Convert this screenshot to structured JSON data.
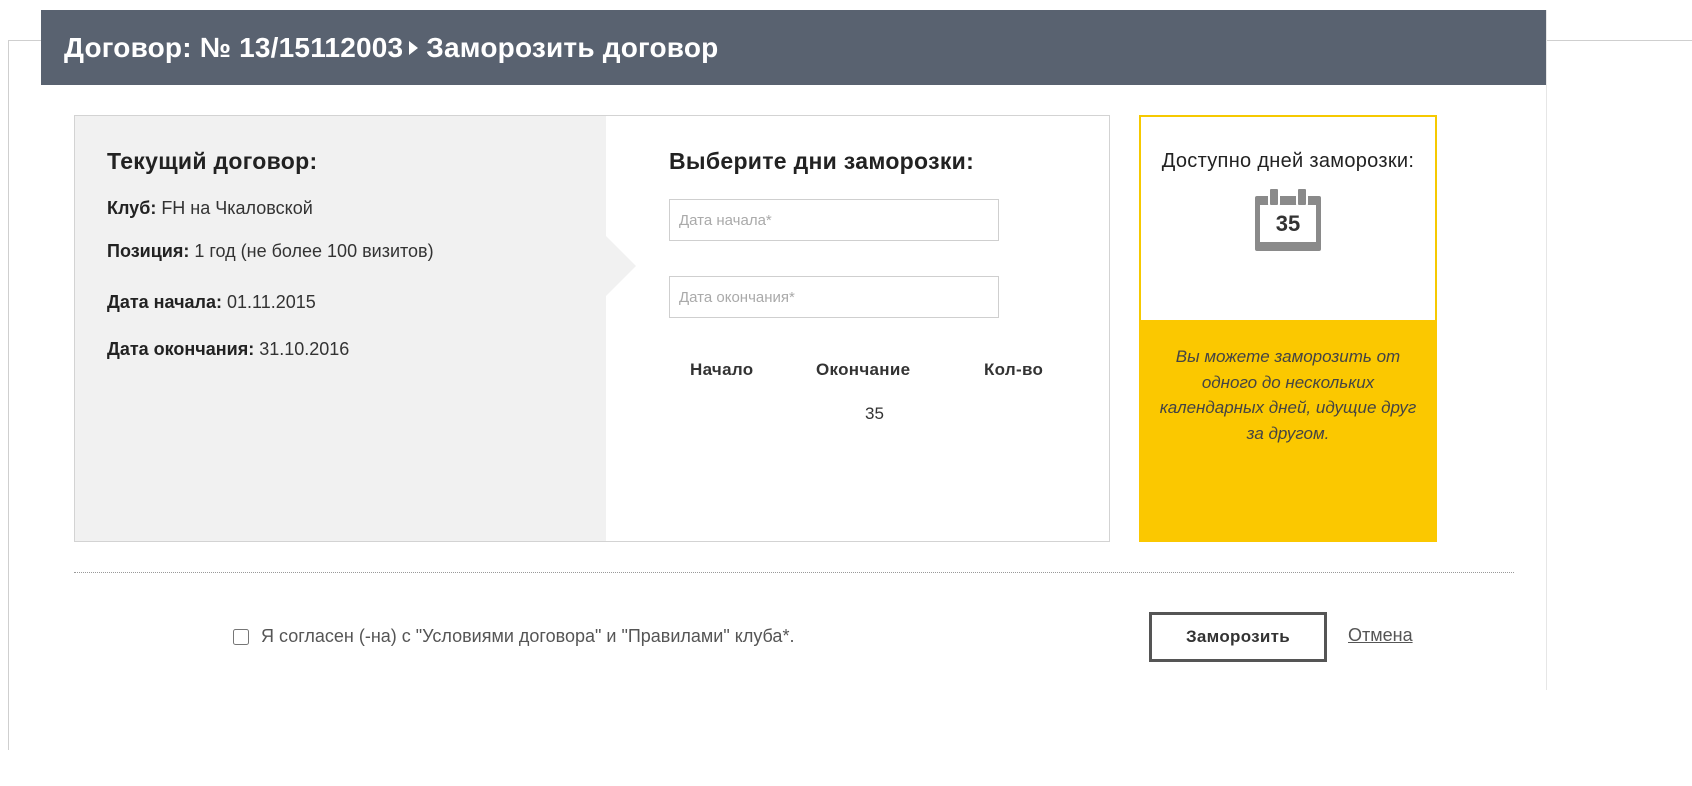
{
  "header": {
    "breadcrumb_root": "Договор: № 13/15112003",
    "breadcrumb_current": "Заморозить договор"
  },
  "current_contract": {
    "title": "Текущий договор:",
    "club_label": "Клуб:",
    "club_value": " FH на Чкаловской",
    "position_label": "Позиция:",
    "position_value": " 1 год (не более 100 визитов)",
    "start_label": "Дата начала:",
    "start_value": " 01.11.2015",
    "end_label": "Дата окончания:",
    "end_value": " 31.10.2016"
  },
  "freeze": {
    "title": "Выберите дни заморозки:",
    "start_placeholder": "Дата начала*",
    "end_placeholder": "Дата окончания*",
    "table_headers": [
      "Начало",
      "Окончание",
      "Кол-во"
    ],
    "count_value": "35"
  },
  "available": {
    "title": "Доступно дней заморозки:",
    "days": "35",
    "note": "Вы можете заморозить от одного до нескольких календарных дней, идущие друг за другом.",
    "calendar_icon": "calendar-icon",
    "accent_color": "#fbc800"
  },
  "footer": {
    "agree_text": "Я согласен (-на) с \"Условиями договора\" и \"Правилами\" клуба*.",
    "freeze_button": "Заморозить",
    "cancel_link": "Отмена"
  },
  "colors": {
    "header_bg": "#596270",
    "left_panel_bg": "#f1f1f1"
  }
}
